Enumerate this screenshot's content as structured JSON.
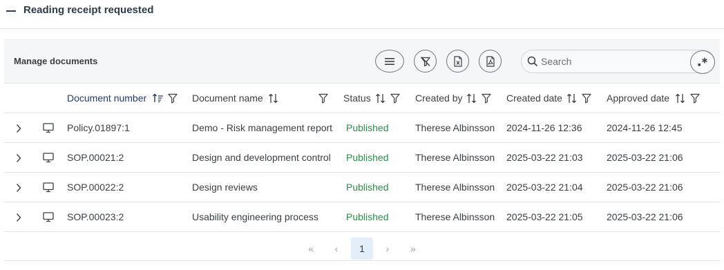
{
  "section": {
    "title": "Reading receipt requested"
  },
  "toolbar": {
    "title": "Manage documents",
    "search_placeholder": "Search"
  },
  "columns": [
    {
      "label": "Document number"
    },
    {
      "label": "Document name"
    },
    {
      "label": "Status"
    },
    {
      "label": "Created by"
    },
    {
      "label": "Created date"
    },
    {
      "label": "Approved date"
    }
  ],
  "rows": [
    {
      "number": "Policy.01897:1",
      "name": "Demo - Risk management report",
      "status": "Published",
      "created_by": "Therese Albinsson",
      "created": "2024-11-26 12:36",
      "approved": "2024-11-26 12:45"
    },
    {
      "number": "SOP.00021:2",
      "name": "Design and development control",
      "status": "Published",
      "created_by": "Therese Albinsson",
      "created": "2025-03-22 21:03",
      "approved": "2025-03-22 21:06"
    },
    {
      "number": "SOP.00022:2",
      "name": "Design reviews",
      "status": "Published",
      "created_by": "Therese Albinsson",
      "created": "2025-03-22 21:04",
      "approved": "2025-03-22 21:06"
    },
    {
      "number": "SOP.00023:2",
      "name": "Usability engineering process",
      "status": "Published",
      "created_by": "Therese Albinsson",
      "created": "2025-03-22 21:05",
      "approved": "2025-03-22 21:06"
    }
  ],
  "pagination": {
    "first": "«",
    "prev": "‹",
    "current": "1",
    "next": "›",
    "last": "»"
  },
  "colors": {
    "accent": "#243a6b",
    "published": "#2e8b4a",
    "active_page_bg": "#e4eef9"
  }
}
